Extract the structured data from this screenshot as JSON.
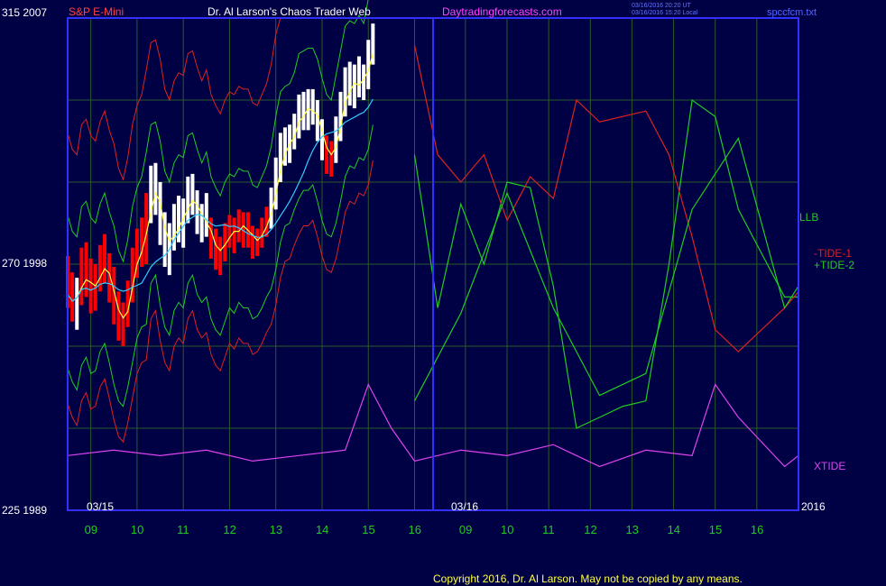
{
  "header": {
    "symbol": "S&P E-Mini",
    "title": "Dr. Al Larson's Chaos Trader Web",
    "site": "Daytradingforecasts.com",
    "time_ut": "03/16/2016 20:20 UT",
    "time_local": "03/16/2016 15:20 Local",
    "file": "spccfcm.txt"
  },
  "y_axis": {
    "top_label": "315 2007",
    "mid_label": "270 1998",
    "bottom_label": "225 1989"
  },
  "x_axis": {
    "date_left": "03/15",
    "date_right": "03/16",
    "year": "2016",
    "hours_left": [
      "09",
      "10",
      "11",
      "12",
      "13",
      "14",
      "15",
      "16"
    ],
    "hours_right": [
      "09",
      "10",
      "11",
      "12",
      "13",
      "14",
      "15",
      "16"
    ]
  },
  "legend": {
    "llb": "LLB",
    "tide1": "-TIDE-1",
    "tide2": "+TIDE-2",
    "xtide": "XTIDE"
  },
  "footer": {
    "copyright": "Copyright 2016, Dr. Al Larson. May not be copied by any means."
  },
  "colors": {
    "background": "#000044",
    "frame": "#3030ff",
    "grid": "#2a5a2a",
    "price_up": "#ffffff",
    "price_down": "#ff0000",
    "yellow_ma": "#ffff44",
    "cyan_ma": "#33ccff",
    "green_band": "#22cc22",
    "red_band": "#dd2222",
    "xtide": "#dd44ee",
    "text_symbol": "#ff4444",
    "text_title": "#ffffff",
    "text_site": "#ff44ff",
    "text_hours": "#22cc22",
    "text_file": "#5566ff"
  },
  "chart_data": {
    "type": "line",
    "ylim_price": [
      1989,
      2007
    ],
    "xlim": [
      8.5,
      24.3
    ],
    "price_bars": [
      {
        "x": 8.5,
        "open": 1997.6,
        "high": 1998.3,
        "low": 1996.4,
        "close": 1996.9,
        "dir": "down"
      },
      {
        "x": 8.6,
        "open": 1996.9,
        "high": 1997.7,
        "low": 1995.9,
        "close": 1996.4,
        "dir": "down"
      },
      {
        "x": 8.7,
        "open": 1996.4,
        "high": 1997.5,
        "low": 1995.6,
        "close": 1997.0,
        "dir": "up"
      },
      {
        "x": 8.8,
        "open": 1997.0,
        "high": 1998.6,
        "low": 1996.5,
        "close": 1998.0,
        "dir": "down"
      },
      {
        "x": 8.9,
        "open": 1998.0,
        "high": 1998.8,
        "low": 1996.8,
        "close": 1997.3,
        "dir": "down"
      },
      {
        "x": 9.0,
        "open": 1997.3,
        "high": 1998.2,
        "low": 1996.2,
        "close": 1996.7,
        "dir": "down"
      },
      {
        "x": 9.1,
        "open": 1996.7,
        "high": 1998.0,
        "low": 1996.3,
        "close": 1997.6,
        "dir": "down"
      },
      {
        "x": 9.2,
        "open": 1997.6,
        "high": 1998.7,
        "low": 1997.0,
        "close": 1998.2,
        "dir": "down"
      },
      {
        "x": 9.3,
        "open": 1998.2,
        "high": 1999.1,
        "low": 1997.3,
        "close": 1997.7,
        "dir": "down"
      },
      {
        "x": 9.4,
        "open": 1997.7,
        "high": 1998.4,
        "low": 1996.6,
        "close": 1997.1,
        "dir": "down"
      },
      {
        "x": 9.5,
        "open": 1997.1,
        "high": 1997.9,
        "low": 1995.8,
        "close": 1996.3,
        "dir": "down"
      },
      {
        "x": 9.6,
        "open": 1996.3,
        "high": 1997.0,
        "low": 1995.2,
        "close": 1995.6,
        "dir": "down"
      },
      {
        "x": 9.7,
        "open": 1995.6,
        "high": 1996.6,
        "low": 1995.0,
        "close": 1996.2,
        "dir": "down"
      },
      {
        "x": 9.8,
        "open": 1996.2,
        "high": 1997.4,
        "low": 1995.7,
        "close": 1997.0,
        "dir": "down"
      },
      {
        "x": 9.9,
        "open": 1997.0,
        "high": 1998.6,
        "low": 1996.6,
        "close": 1998.2,
        "dir": "down"
      },
      {
        "x": 10.0,
        "open": 1998.2,
        "high": 1999.3,
        "low": 1997.5,
        "close": 1998.8,
        "dir": "down"
      },
      {
        "x": 10.1,
        "open": 1998.8,
        "high": 1999.7,
        "low": 1997.9,
        "close": 1998.3,
        "dir": "down"
      },
      {
        "x": 10.2,
        "open": 1998.3,
        "high": 2000.6,
        "low": 1998.0,
        "close": 2000.2,
        "dir": "down"
      },
      {
        "x": 10.3,
        "open": 2000.2,
        "high": 2001.6,
        "low": 1999.5,
        "close": 2001.2,
        "dir": "up"
      },
      {
        "x": 10.4,
        "open": 2001.2,
        "high": 2001.7,
        "low": 1999.8,
        "close": 2000.4,
        "dir": "up"
      },
      {
        "x": 10.5,
        "open": 2000.4,
        "high": 2001.0,
        "low": 1998.7,
        "close": 1999.2,
        "dir": "up"
      },
      {
        "x": 10.6,
        "open": 1999.2,
        "high": 1999.9,
        "low": 1997.9,
        "close": 1998.4,
        "dir": "up"
      },
      {
        "x": 10.7,
        "open": 1998.4,
        "high": 1999.5,
        "low": 1997.6,
        "close": 1998.9,
        "dir": "up"
      },
      {
        "x": 10.8,
        "open": 1998.9,
        "high": 2000.2,
        "low": 1998.5,
        "close": 1999.8,
        "dir": "up"
      },
      {
        "x": 10.9,
        "open": 1999.8,
        "high": 2000.5,
        "low": 1998.8,
        "close": 1999.2,
        "dir": "up"
      },
      {
        "x": 11.0,
        "open": 1999.2,
        "high": 2000.4,
        "low": 1998.6,
        "close": 2000.0,
        "dir": "up"
      },
      {
        "x": 11.1,
        "open": 2000.0,
        "high": 2001.2,
        "low": 1999.5,
        "close": 2000.8,
        "dir": "up"
      },
      {
        "x": 11.2,
        "open": 2000.8,
        "high": 2001.3,
        "low": 1999.8,
        "close": 2000.2,
        "dir": "up"
      },
      {
        "x": 11.3,
        "open": 2000.2,
        "high": 2000.7,
        "low": 1999.1,
        "close": 1999.5,
        "dir": "up"
      },
      {
        "x": 11.4,
        "open": 1999.5,
        "high": 2000.2,
        "low": 1998.8,
        "close": 1999.8,
        "dir": "up"
      },
      {
        "x": 11.5,
        "open": 1999.8,
        "high": 2000.6,
        "low": 1999.0,
        "close": 1999.3,
        "dir": "up"
      },
      {
        "x": 11.6,
        "open": 1999.3,
        "high": 1999.7,
        "low": 1998.2,
        "close": 1998.6,
        "dir": "down"
      },
      {
        "x": 11.7,
        "open": 1998.6,
        "high": 1999.3,
        "low": 1997.8,
        "close": 1998.2,
        "dir": "down"
      },
      {
        "x": 11.8,
        "open": 1998.2,
        "high": 1999.0,
        "low": 1997.6,
        "close": 1998.7,
        "dir": "down"
      },
      {
        "x": 11.9,
        "open": 1998.7,
        "high": 1999.5,
        "low": 1998.1,
        "close": 1999.2,
        "dir": "down"
      },
      {
        "x": 12.0,
        "open": 1999.2,
        "high": 1999.8,
        "low": 1998.6,
        "close": 1999.0,
        "dir": "down"
      },
      {
        "x": 12.1,
        "open": 1999.0,
        "high": 1999.7,
        "low": 1998.4,
        "close": 1999.4,
        "dir": "down"
      },
      {
        "x": 12.2,
        "open": 1999.4,
        "high": 2000.0,
        "low": 1998.8,
        "close": 1999.2,
        "dir": "down"
      },
      {
        "x": 12.3,
        "open": 1999.2,
        "high": 1999.9,
        "low": 1998.6,
        "close": 1999.6,
        "dir": "down"
      },
      {
        "x": 12.4,
        "open": 1999.6,
        "high": 1999.9,
        "low": 1998.6,
        "close": 1998.9,
        "dir": "down"
      },
      {
        "x": 12.5,
        "open": 1998.9,
        "high": 1999.4,
        "low": 1998.2,
        "close": 1998.7,
        "dir": "down"
      },
      {
        "x": 12.6,
        "open": 1998.7,
        "high": 1999.3,
        "low": 1998.3,
        "close": 1999.0,
        "dir": "down"
      },
      {
        "x": 12.7,
        "open": 1999.0,
        "high": 1999.7,
        "low": 1998.6,
        "close": 1999.4,
        "dir": "down"
      },
      {
        "x": 12.8,
        "open": 1999.4,
        "high": 2000.1,
        "low": 1999.0,
        "close": 1999.7,
        "dir": "down"
      },
      {
        "x": 12.9,
        "open": 1999.7,
        "high": 2000.8,
        "low": 1999.3,
        "close": 2000.4,
        "dir": "up"
      },
      {
        "x": 13.0,
        "open": 2000.4,
        "high": 2001.9,
        "low": 2000.0,
        "close": 2001.5,
        "dir": "up"
      },
      {
        "x": 13.1,
        "open": 2001.5,
        "high": 2002.8,
        "low": 2001.0,
        "close": 2002.4,
        "dir": "up"
      },
      {
        "x": 13.2,
        "open": 2002.4,
        "high": 2003.0,
        "low": 2001.6,
        "close": 2002.1,
        "dir": "up"
      },
      {
        "x": 13.3,
        "open": 2002.1,
        "high": 2003.1,
        "low": 2001.7,
        "close": 2002.7,
        "dir": "up"
      },
      {
        "x": 13.4,
        "open": 2002.7,
        "high": 2003.5,
        "low": 2002.2,
        "close": 2003.1,
        "dir": "up"
      },
      {
        "x": 13.5,
        "open": 2003.1,
        "high": 2004.2,
        "low": 2002.6,
        "close": 2003.8,
        "dir": "up"
      },
      {
        "x": 13.6,
        "open": 2003.8,
        "high": 2004.3,
        "low": 2002.9,
        "close": 2003.3,
        "dir": "up"
      },
      {
        "x": 13.7,
        "open": 2003.3,
        "high": 2004.4,
        "low": 2002.9,
        "close": 2004.0,
        "dir": "up"
      },
      {
        "x": 13.8,
        "open": 2004.0,
        "high": 2004.4,
        "low": 2003.1,
        "close": 2003.5,
        "dir": "up"
      },
      {
        "x": 13.9,
        "open": 2003.5,
        "high": 2004.0,
        "low": 2002.5,
        "close": 2002.9,
        "dir": "up"
      },
      {
        "x": 14.0,
        "open": 2002.9,
        "high": 2003.3,
        "low": 2001.8,
        "close": 2002.2,
        "dir": "up"
      },
      {
        "x": 14.1,
        "open": 2002.2,
        "high": 2002.7,
        "low": 2001.3,
        "close": 2001.7,
        "dir": "down"
      },
      {
        "x": 14.2,
        "open": 2001.7,
        "high": 2002.5,
        "low": 2001.2,
        "close": 2002.1,
        "dir": "down"
      },
      {
        "x": 14.3,
        "open": 2002.1,
        "high": 2003.4,
        "low": 2001.7,
        "close": 2003.0,
        "dir": "up"
      },
      {
        "x": 14.4,
        "open": 2003.0,
        "high": 2004.3,
        "low": 2002.5,
        "close": 2003.9,
        "dir": "up"
      },
      {
        "x": 14.5,
        "open": 2003.9,
        "high": 2005.2,
        "low": 2003.4,
        "close": 2004.8,
        "dir": "up"
      },
      {
        "x": 14.6,
        "open": 2004.8,
        "high": 2005.4,
        "low": 2003.8,
        "close": 2004.2,
        "dir": "up"
      },
      {
        "x": 14.7,
        "open": 2004.2,
        "high": 2005.3,
        "low": 2003.7,
        "close": 2004.9,
        "dir": "up"
      },
      {
        "x": 14.8,
        "open": 2004.9,
        "high": 2005.6,
        "low": 2004.1,
        "close": 2004.5,
        "dir": "up"
      },
      {
        "x": 14.9,
        "open": 2004.5,
        "high": 2005.3,
        "low": 2004.0,
        "close": 2004.9,
        "dir": "up"
      },
      {
        "x": 15.0,
        "open": 2004.9,
        "high": 2006.2,
        "low": 2004.4,
        "close": 2005.8,
        "dir": "up"
      },
      {
        "x": 15.1,
        "open": 2005.8,
        "high": 2006.8,
        "low": 2005.3,
        "close": 2006.4,
        "dir": "up"
      }
    ],
    "series": [
      {
        "name": "LLB",
        "color": "#22cc22",
        "x": [
          16.0,
          16.5,
          17.0,
          17.5,
          18.0,
          18.5,
          19.0,
          19.5,
          20.0,
          20.5,
          21.0,
          21.5,
          22.0,
          22.5,
          23.0,
          23.5,
          24.0,
          24.3
        ],
        "y": [
          290,
          262,
          281,
          270,
          285,
          284,
          266,
          240,
          242,
          244,
          245,
          270,
          300,
          297,
          280,
          272,
          264,
          264
        ]
      },
      {
        "name": "-TIDE-1",
        "color": "#dd2222",
        "x": [
          16.0,
          16.5,
          17.0,
          17.5,
          18.0,
          18.5,
          19.0,
          19.5,
          20.0,
          20.5,
          21.0,
          21.5,
          22.0,
          22.5,
          23.0,
          23.5,
          24.0,
          24.3
        ],
        "y": [
          310,
          290,
          285,
          290,
          278,
          286,
          282,
          300,
          296,
          297,
          298,
          290,
          275,
          258,
          254,
          258,
          262,
          265
        ]
      },
      {
        "name": "+TIDE-2",
        "color": "#22cc22",
        "x": [
          16.0,
          17.0,
          18.0,
          19.0,
          20.0,
          21.0,
          22.0,
          23.0,
          24.0,
          24.3
        ],
        "y": [
          245,
          261,
          283,
          262,
          246,
          250,
          280,
          293,
          262,
          266
        ]
      },
      {
        "name": "XTIDE",
        "color": "#dd44ee",
        "x": [
          8.5,
          9.5,
          10.5,
          11.5,
          12.5,
          13.5,
          14.5,
          15.0,
          15.5,
          16.0,
          17.0,
          18.0,
          19.0,
          20.0,
          21.0,
          22.0,
          22.5,
          23.0,
          24.0,
          24.3
        ],
        "y": [
          235,
          236,
          235,
          236,
          234,
          235,
          236,
          248,
          240,
          234,
          236,
          235,
          237,
          233,
          236,
          235,
          248,
          242,
          233,
          235
        ]
      }
    ]
  }
}
